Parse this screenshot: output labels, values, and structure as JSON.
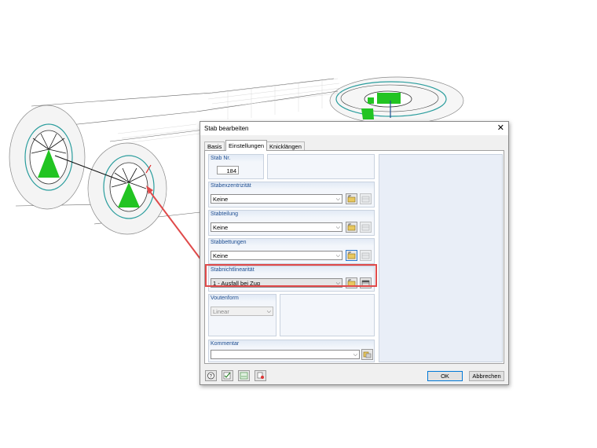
{
  "dialog": {
    "title": "Stab bearbeiten",
    "close_icon": "✕"
  },
  "tabs": [
    {
      "label": "Basis",
      "active": false
    },
    {
      "label": "Einstellungen",
      "active": true
    },
    {
      "label": "Knicklängen",
      "active": false
    }
  ],
  "stab": {
    "header": "Stab Nr.",
    "number": "184"
  },
  "groups": {
    "exzentrizitaet": {
      "header": "Stabexzentrizität",
      "value": "Keine"
    },
    "teilung": {
      "header": "Stabteilung",
      "value": "Keine"
    },
    "bettungen": {
      "header": "Stabbettungen",
      "value": "Keine"
    },
    "nichtlinearitaet": {
      "header": "Stabnichtlinearität",
      "value": "1 - Ausfall bei Zug"
    },
    "voutenform": {
      "header": "Voutenform",
      "value": "Linear"
    },
    "kommentar": {
      "header": "Kommentar",
      "value": ""
    }
  },
  "icons": {
    "new": "new-folder-icon",
    "edit": "edit-table-icon",
    "help": "help-icon",
    "check": "check-edit-icon",
    "units": "units-icon",
    "mode": "display-mode-icon",
    "comment": "comment-library-icon"
  },
  "buttons": {
    "ok": "OK",
    "cancel": "Abbrechen"
  },
  "colors": {
    "accent": "#1f4f92",
    "highlight": "#e04a4a",
    "model_green": "#22c422",
    "model_teal": "#2a9d9d"
  }
}
